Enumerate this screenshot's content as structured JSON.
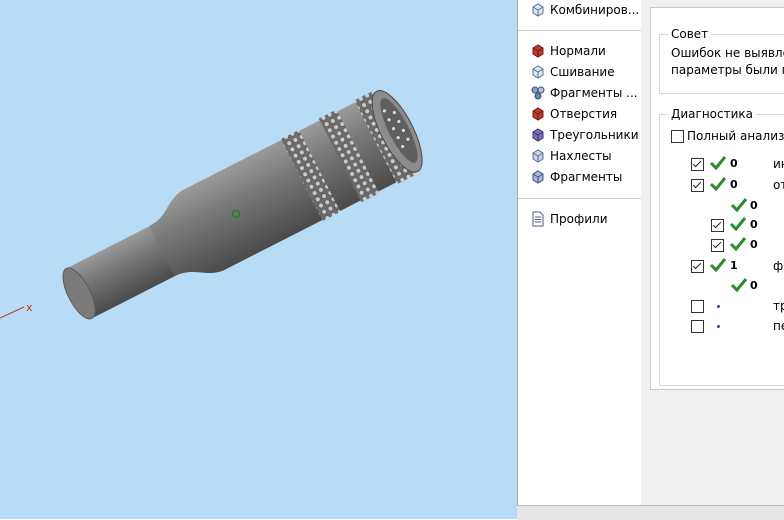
{
  "sidebar": {
    "top_item": "Комбиниров...",
    "items": [
      {
        "label": "Нормали",
        "icon": "normals-icon"
      },
      {
        "label": "Сшивание",
        "icon": "stitching-icon"
      },
      {
        "label": "Фрагменты ...",
        "icon": "fragments-settings-icon"
      },
      {
        "label": "Отверстия",
        "icon": "holes-icon"
      },
      {
        "label": "Треугольники",
        "icon": "triangles-icon"
      },
      {
        "label": "Нахлесты",
        "icon": "overlaps-icon"
      },
      {
        "label": "Фрагменты",
        "icon": "fragments-icon"
      }
    ],
    "bottom_item": "Профили"
  },
  "viewport": {
    "axis_label": "x"
  },
  "advice": {
    "title": "Совет",
    "line1": "Ошибок не выявлено",
    "line2": "параметры были про"
  },
  "diagnostics": {
    "title": "Диагностика",
    "full_analysis_label": "Полный анализ",
    "rows": [
      {
        "value": "0",
        "label": "ин"
      },
      {
        "value": "0",
        "label": "от"
      },
      {
        "value": "0",
        "label": ""
      },
      {
        "value": "0",
        "label": ""
      },
      {
        "value": "0",
        "label": ""
      },
      {
        "value": "1",
        "label": "ф"
      },
      {
        "value": "0",
        "label": ""
      },
      {
        "value": "",
        "label": "тр"
      },
      {
        "value": "",
        "label": "пе"
      }
    ]
  }
}
